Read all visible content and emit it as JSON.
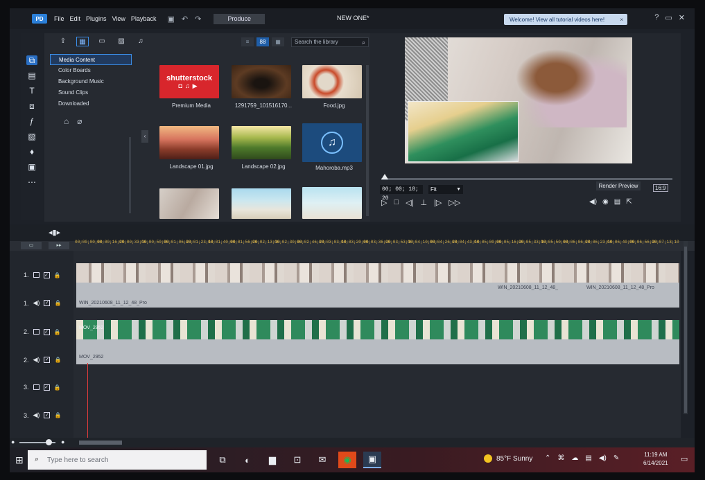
{
  "menu": {
    "logo": "PD",
    "items": [
      "File",
      "Edit",
      "Plugins",
      "View",
      "Playback"
    ],
    "produce": "Produce",
    "project_title": "NEW ONE*",
    "welcome": "Welcome! View all tutorial videos here!",
    "welcome_close": "×"
  },
  "window_controls": [
    "?",
    "▭",
    "✕"
  ],
  "library": {
    "search_placeholder": "Search the library",
    "view_toggle": "88",
    "tree": [
      "Media Content",
      "Color Boards",
      "Background Music",
      "Sound Clips",
      "Downloaded"
    ],
    "items": [
      {
        "caption": "Premium Media",
        "thumb": "shutterstock",
        "thumb_text": "shutterstock"
      },
      {
        "caption": "1291759_101516170...",
        "thumb": "dog"
      },
      {
        "caption": "Food.jpg",
        "thumb": "food"
      },
      {
        "caption": "Landscape 01.jpg",
        "thumb": "land1"
      },
      {
        "caption": "Landscape 02.jpg",
        "thumb": "land2"
      },
      {
        "caption": "Mahoroba.mp3",
        "thumb": "music"
      },
      {
        "caption": "",
        "thumb": "room"
      },
      {
        "caption": "",
        "thumb": "beach"
      },
      {
        "caption": "",
        "thumb": "beach2"
      }
    ]
  },
  "preview": {
    "timecode": "00; 00; 18; 20",
    "fit": "Fit",
    "render_preview": "Render Preview",
    "ratio": "16:9",
    "scrub_progress": 0.02
  },
  "timeline": {
    "ruler": [
      "00;00;00;00",
      "00;00;16;20",
      "00;00;33;10",
      "00;00;50;00",
      "00;01;06;20",
      "00;01;23;10",
      "00;01;40;00",
      "00;01;56;20",
      "00;02;13;10",
      "00;02;30;00",
      "00;02;46;20",
      "00;03;03;10",
      "00;03;20;00",
      "00;03;36;20",
      "00;03;53;10",
      "00;04;10;00",
      "00;04;26;20",
      "00;04;43;10",
      "00;05;00;00",
      "00;05;16;20",
      "00;05;33;10",
      "00;05;50;00",
      "00;06;06;20",
      "00;06;23;10",
      "00;06;40;00",
      "00;06;56;20",
      "00;07;13;10"
    ],
    "tracks": [
      {
        "label": "1.",
        "type": "video"
      },
      {
        "label": "1.",
        "type": "audio"
      },
      {
        "label": "2.",
        "type": "video"
      },
      {
        "label": "2.",
        "type": "audio"
      },
      {
        "label": "3.",
        "type": "video"
      },
      {
        "label": "3.",
        "type": "audio"
      }
    ],
    "clips": {
      "track1_audio_label": "WIN_20210608_11_12_48_Pro",
      "track1_audio_label2": "WIN_20210608_11_12_48_",
      "track1_audio_label3": "WIN_20210608_11_12_48_Pro",
      "track2_video_label": "MOV_2952",
      "track2_audio_label": "MOV_2952"
    }
  },
  "taskbar": {
    "search_placeholder": "Type here to search",
    "weather": "85°F  Sunny",
    "time": "11:19 AM",
    "date": "6/14/2021"
  }
}
